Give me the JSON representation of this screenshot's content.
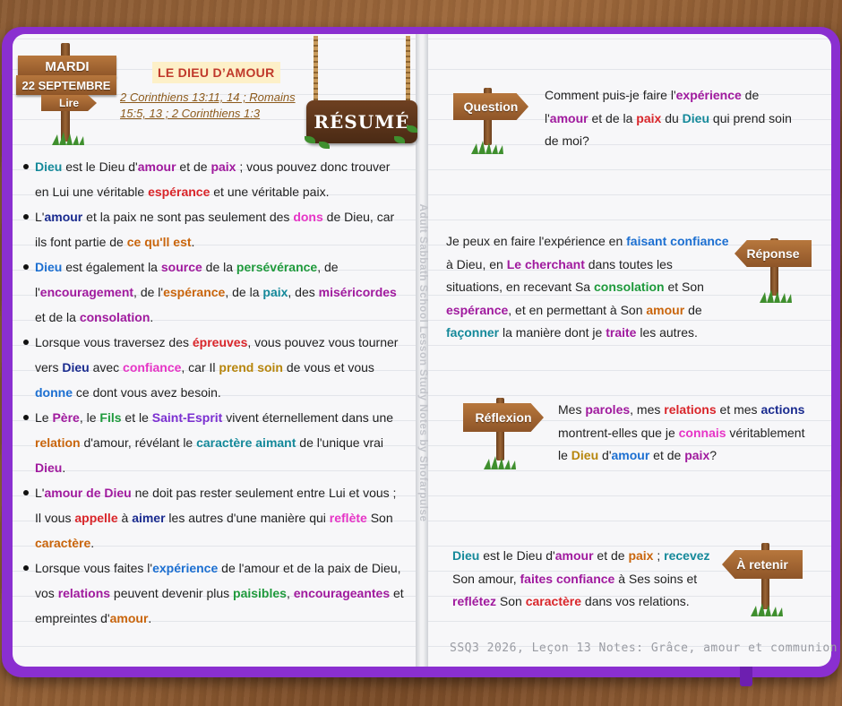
{
  "left": {
    "date": {
      "day": "MARDI",
      "date": "22 SEPTEMBRE",
      "read": "Lire"
    },
    "title": "LE DIEU D’AMOUR",
    "refs": "2 Corinthiens 13:11, 14 ; Romains 15:5, 13 ; 2 Corinthiens 1:3",
    "resume": "RÉSUMÉ",
    "bullets": [
      [
        {
          "t": "Dieu",
          "c": "teal"
        },
        {
          "t": " est le Dieu d'"
        },
        {
          "t": "amour",
          "c": "purple"
        },
        {
          "t": " et de "
        },
        {
          "t": "paix",
          "c": "purple"
        },
        {
          "t": " ; vous pouvez donc trouver en Lui une véritable "
        },
        {
          "t": "espérance",
          "c": "red"
        },
        {
          "t": " et une véritable paix."
        }
      ],
      [
        {
          "t": "L'"
        },
        {
          "t": "amour",
          "c": "navy"
        },
        {
          "t": " et la paix ne sont pas seulement des "
        },
        {
          "t": "dons",
          "c": "magenta"
        },
        {
          "t": " de Dieu, car ils font partie de "
        },
        {
          "t": "ce qu'll est",
          "c": "orange"
        },
        {
          "t": "."
        }
      ],
      [
        {
          "t": "Dieu",
          "c": "blue"
        },
        {
          "t": " est également la "
        },
        {
          "t": "source",
          "c": "purple"
        },
        {
          "t": " de la "
        },
        {
          "t": "persévérance",
          "c": "green"
        },
        {
          "t": ", de l'"
        },
        {
          "t": "encouragement",
          "c": "purple"
        },
        {
          "t": ", de l'"
        },
        {
          "t": "espérance",
          "c": "orange"
        },
        {
          "t": ", de la "
        },
        {
          "t": "paix",
          "c": "teal"
        },
        {
          "t": ", des "
        },
        {
          "t": "miséricordes",
          "c": "purple"
        },
        {
          "t": " et de la "
        },
        {
          "t": "consolation",
          "c": "purple"
        },
        {
          "t": "."
        }
      ],
      [
        {
          "t": "Lorsque vous traversez des "
        },
        {
          "t": "épreuves",
          "c": "red"
        },
        {
          "t": ", vous pouvez vous tourner vers "
        },
        {
          "t": "Dieu",
          "c": "navy"
        },
        {
          "t": " avec "
        },
        {
          "t": "confiance",
          "c": "magenta"
        },
        {
          "t": ", car Il "
        },
        {
          "t": "prend soin",
          "c": "gold"
        },
        {
          "t": " de vous et vous "
        },
        {
          "t": "donne",
          "c": "blue"
        },
        {
          "t": " ce dont vous avez besoin."
        }
      ],
      [
        {
          "t": "Le "
        },
        {
          "t": "Père",
          "c": "purple"
        },
        {
          "t": ", le "
        },
        {
          "t": "Fils",
          "c": "green"
        },
        {
          "t": " et le "
        },
        {
          "t": "Saint-Esprit",
          "c": "violet"
        },
        {
          "t": " vivent éternellement dans une "
        },
        {
          "t": "relation",
          "c": "orange"
        },
        {
          "t": " d'amour, révélant le "
        },
        {
          "t": "caractère aimant",
          "c": "teal"
        },
        {
          "t": " de l'unique vrai "
        },
        {
          "t": "Dieu",
          "c": "purple"
        },
        {
          "t": "."
        }
      ],
      [
        {
          "t": "L'"
        },
        {
          "t": "amour de Dieu",
          "c": "purple"
        },
        {
          "t": " ne doit pas rester seulement entre Lui et vous ; Il vous "
        },
        {
          "t": "appelle",
          "c": "red"
        },
        {
          "t": " à "
        },
        {
          "t": "aimer",
          "c": "navy"
        },
        {
          "t": " les autres d'une manière qui "
        },
        {
          "t": "reflète",
          "c": "magenta"
        },
        {
          "t": " Son "
        },
        {
          "t": "caractère",
          "c": "orange"
        },
        {
          "t": "."
        }
      ],
      [
        {
          "t": "Lorsque vous faites l'"
        },
        {
          "t": "expérience",
          "c": "blue"
        },
        {
          "t": " de l'amour et de la paix de Dieu, vos "
        },
        {
          "t": "relations",
          "c": "purple"
        },
        {
          "t": " peuvent devenir plus "
        },
        {
          "t": "paisibles",
          "c": "green"
        },
        {
          "t": ", "
        },
        {
          "t": "encourageantes",
          "c": "purple"
        },
        {
          "t": " et empreintes d'"
        },
        {
          "t": "amour",
          "c": "orange"
        },
        {
          "t": "."
        }
      ]
    ]
  },
  "vertical_text": "Adult Sabbath School Lesson Study Notes by Shofarpulse",
  "right": {
    "question": {
      "label": "Question",
      "text": [
        {
          "t": "Comment puis-je faire l'"
        },
        {
          "t": "expérience",
          "c": "purple"
        },
        {
          "t": " de l'"
        },
        {
          "t": "amour",
          "c": "purple"
        },
        {
          "t": " et de la "
        },
        {
          "t": "paix",
          "c": "red"
        },
        {
          "t": " du "
        },
        {
          "t": "Dieu",
          "c": "teal"
        },
        {
          "t": " qui prend soin de moi?"
        }
      ]
    },
    "reponse": {
      "label": "Réponse",
      "text": [
        {
          "t": "Je peux en faire l'expérience en "
        },
        {
          "t": "faisant confiance",
          "c": "blue"
        },
        {
          "t": " à Dieu, en "
        },
        {
          "t": "Le cherchant",
          "c": "purple"
        },
        {
          "t": " dans toutes les situations, en recevant Sa "
        },
        {
          "t": "consolation",
          "c": "green"
        },
        {
          "t": " et Son "
        },
        {
          "t": "espérance",
          "c": "purple"
        },
        {
          "t": ", et en permettant à Son "
        },
        {
          "t": "amour",
          "c": "orange"
        },
        {
          "t": " de "
        },
        {
          "t": "façonner",
          "c": "teal"
        },
        {
          "t": " la manière dont je "
        },
        {
          "t": "traite",
          "c": "purple"
        },
        {
          "t": " les autres."
        }
      ]
    },
    "reflexion": {
      "label": "Réflexion",
      "text": [
        {
          "t": "Mes "
        },
        {
          "t": "paroles",
          "c": "purple"
        },
        {
          "t": ", mes "
        },
        {
          "t": "relations",
          "c": "red"
        },
        {
          "t": " et mes "
        },
        {
          "t": "actions",
          "c": "navy"
        },
        {
          "t": " montrent-elles que je "
        },
        {
          "t": "connais",
          "c": "magenta"
        },
        {
          "t": " véritablement le "
        },
        {
          "t": "Dieu",
          "c": "gold"
        },
        {
          "t": " d'"
        },
        {
          "t": "amour",
          "c": "blue"
        },
        {
          "t": " et de "
        },
        {
          "t": "paix",
          "c": "purple"
        },
        {
          "t": "?"
        }
      ]
    },
    "retenir": {
      "label": "À retenir",
      "text": [
        {
          "t": "Dieu",
          "c": "teal"
        },
        {
          "t": " est le Dieu d'"
        },
        {
          "t": "amour",
          "c": "purple"
        },
        {
          "t": " et de "
        },
        {
          "t": "paix",
          "c": "orange"
        },
        {
          "t": " ; "
        },
        {
          "t": "recevez",
          "c": "teal"
        },
        {
          "t": " Son amour, "
        },
        {
          "t": "faites confiance",
          "c": "purple"
        },
        {
          "t": " à Ses soins et "
        },
        {
          "t": "reflétez",
          "c": "purple"
        },
        {
          "t": " Son "
        },
        {
          "t": "caractère",
          "c": "red"
        },
        {
          "t": " dans vos relations."
        }
      ]
    },
    "footer": "SSQ3 2026, Leçon 13 Notes: Grâce, amour et communion"
  }
}
